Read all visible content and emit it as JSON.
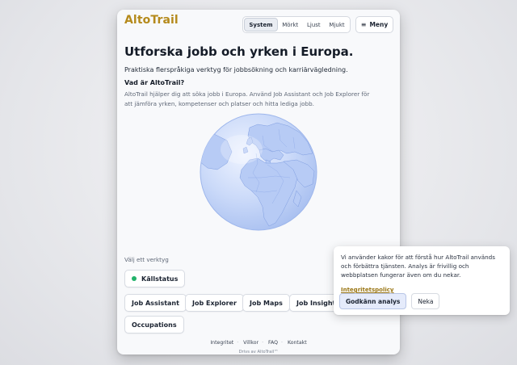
{
  "header": {
    "logo": "AltoTrail",
    "theme_options": [
      "System",
      "Mörkt",
      "Ljust",
      "Mjukt"
    ],
    "theme_selected": "System",
    "menu_label": "Meny"
  },
  "hero": {
    "title": "Utforska jobb och yrken i Europa.",
    "lead": "Praktiska flerspråkiga verktyg för jobbsökning och karriärvägledning.",
    "subhead": "Vad är AltoTrail?",
    "body": "AltoTrail hjälper dig att söka jobb i Europa. Använd Job Assistant och Job Explorer för att jämföra yrken, kompetenser och platser och hitta lediga jobb."
  },
  "tools": {
    "label": "Välj ett verktyg",
    "source_status": "Källstatus",
    "items": [
      "Job Assistant",
      "Job Explorer",
      "Job Maps",
      "Job Insights",
      "Occupations"
    ]
  },
  "footer": {
    "links": [
      "Integritet",
      "Villkor",
      "FAQ",
      "Kontakt"
    ],
    "powered_by": "Drivs av AltoTrail™"
  },
  "cookie": {
    "text": "Vi använder kakor för att förstå hur AltoTrail används och förbättra tjänsten. Analys är frivillig och webbplatsen fungerar även om du nekar.",
    "policy_link": "Integritetspolicy",
    "accept": "Godkänn analys",
    "decline": "Neka"
  },
  "colors": {
    "brand": "#b58a1c",
    "globe": "#b9cdf6",
    "status_ok": "#22b26a"
  }
}
